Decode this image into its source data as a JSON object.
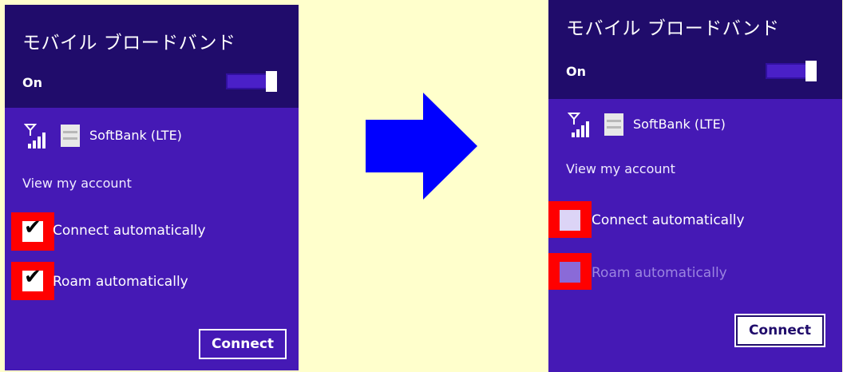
{
  "colors": {
    "background": "#ffffcc",
    "panel": "#4519b5",
    "header": "#200c6b",
    "highlight": "#ff0000",
    "arrow": "#0000ff"
  },
  "before": {
    "title": "モバイル ブロードバンド",
    "power_label": "On",
    "power_toggle_on": true,
    "network_name": "SoftBank (LTE)",
    "account_link": "View my account",
    "connect_auto_label": "Connect automatically",
    "connect_auto_checked": true,
    "roam_auto_label": "Roam automatically",
    "roam_auto_checked": true,
    "connect_button": "Connect",
    "check_glyph": "✔"
  },
  "after": {
    "title": "モバイル ブロードバンド",
    "power_label": "On",
    "power_toggle_on": true,
    "network_name": "SoftBank (LTE)",
    "account_link": "View my account",
    "connect_auto_label": "Connect automatically",
    "connect_auto_checked": false,
    "roam_auto_label": "Roam automatically",
    "roam_auto_checked": false,
    "roam_auto_disabled": true,
    "connect_button": "Connect"
  },
  "icons": {
    "signal": "signal-bars-icon",
    "sim": "sim-card-icon",
    "arrow": "right-arrow-icon"
  }
}
